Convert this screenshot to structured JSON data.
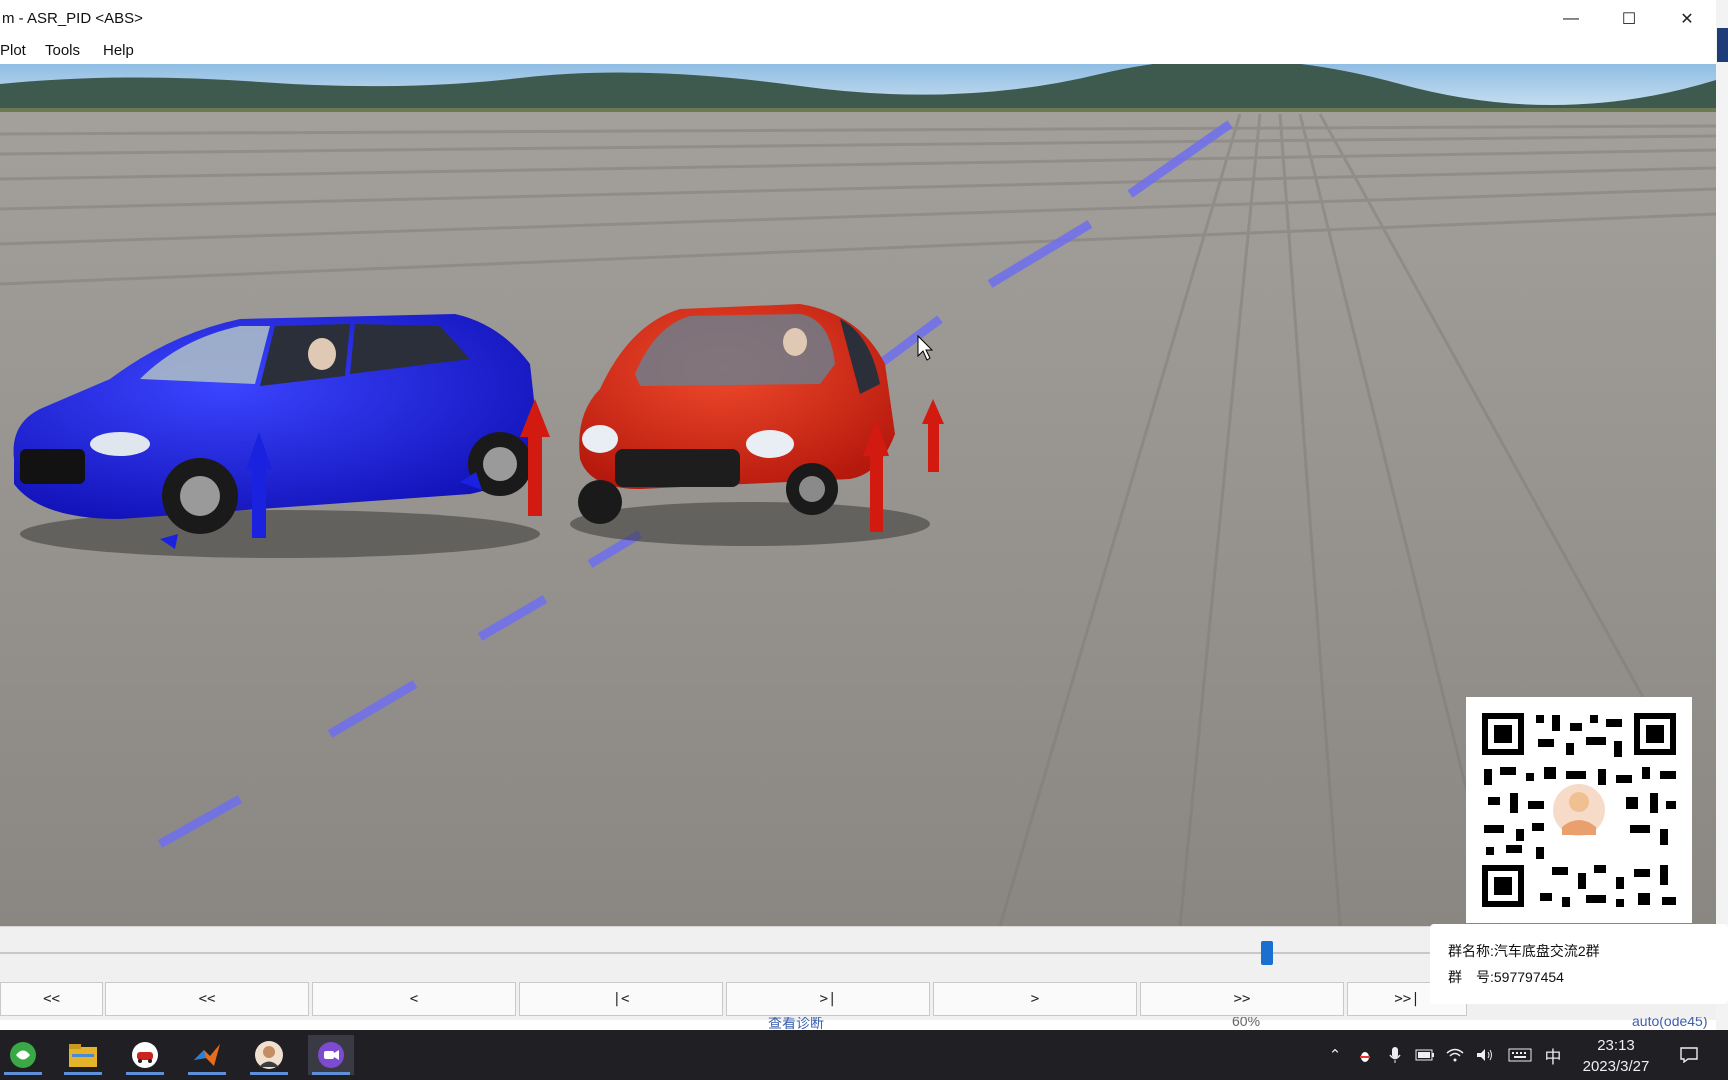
{
  "window": {
    "title": "m - ASR_PID <ABS>",
    "controls": {
      "minimize": "—",
      "maximize": "☐",
      "close": "✕"
    }
  },
  "menu": {
    "items": [
      "Plot",
      "Tools",
      "Help"
    ]
  },
  "playback": {
    "buttons": [
      "<<",
      "<<",
      "<",
      "|<",
      ">|",
      ">",
      ">>",
      ">>|"
    ],
    "position_fraction": 0.74
  },
  "status": {
    "left": "查看诊断",
    "middle": "60%",
    "right": "auto(ode45)"
  },
  "qr": {
    "group_name": "群名称:汽车底盘交流2群",
    "group_number": "群　号:597797454"
  },
  "taskbar": {
    "apps": [
      "browser-icon",
      "file-explorer-icon",
      "carsim-icon",
      "matlab-icon",
      "user-avatar-icon",
      "video-recorder-icon"
    ],
    "tray": {
      "ime": "中",
      "time": "23:13",
      "date": "2023/3/27"
    }
  },
  "colors": {
    "blue_car": "#1a1fd6",
    "red_car": "#d92a1a",
    "road": "#8a8783",
    "sky": "#9fc6e8",
    "force_arrow_red": "#d21a10",
    "force_arrow_blue": "#1a22e0"
  }
}
